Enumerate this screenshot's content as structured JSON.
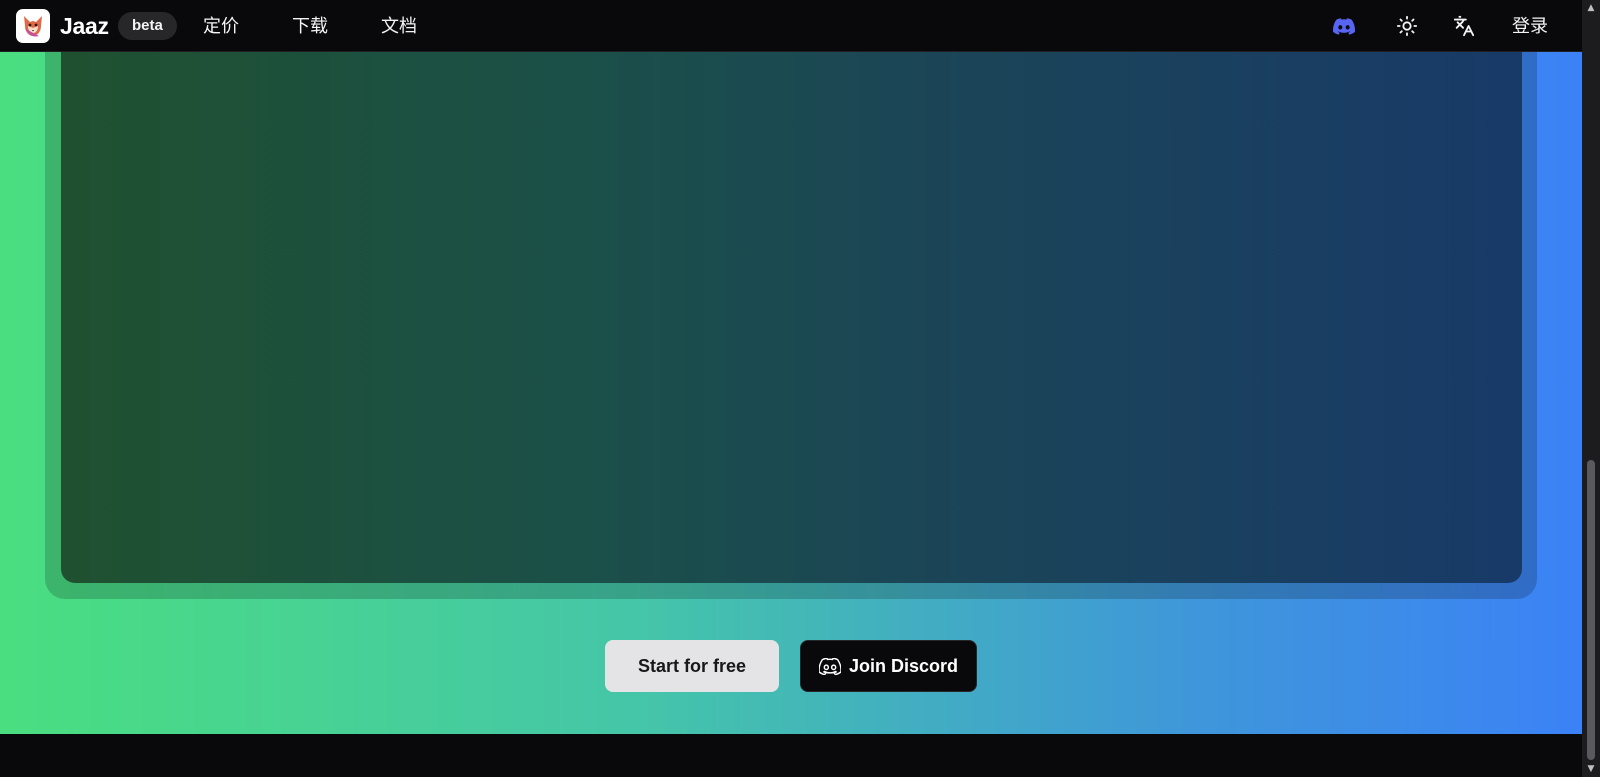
{
  "header": {
    "brand": "Jaaz",
    "badge": "beta",
    "nav": {
      "pricing": "定价",
      "download": "下载",
      "docs": "文档"
    },
    "icons": {
      "discord": "discord-icon",
      "theme": "sun-icon",
      "language": "translate-icon"
    },
    "login": "登录"
  },
  "hero": {
    "start_label": "Start for free",
    "discord_label": "Join Discord"
  },
  "colors": {
    "gradient_start": "#4ade80",
    "gradient_end": "#3b82f6",
    "discord_brand": "#5865f2"
  }
}
